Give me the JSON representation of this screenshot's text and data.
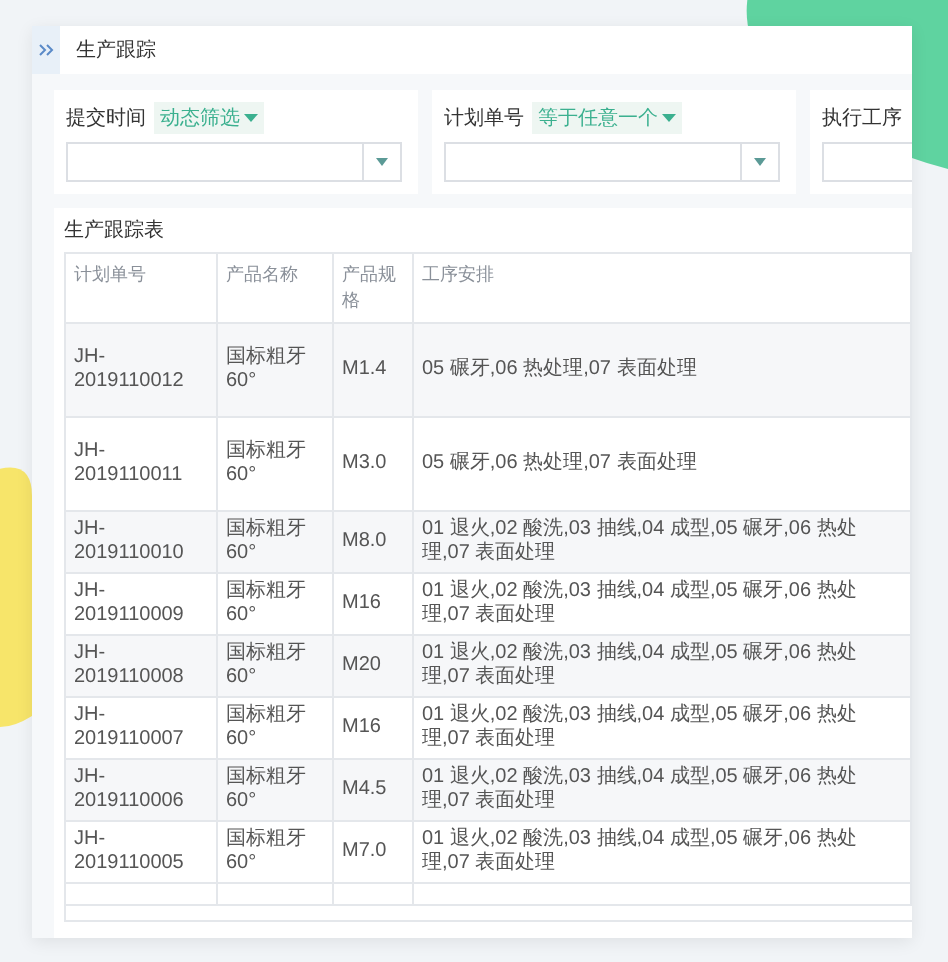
{
  "header": {
    "title": "生产跟踪"
  },
  "filters": [
    {
      "label": "提交时间",
      "operator": "动态筛选"
    },
    {
      "label": "计划单号",
      "operator": "等于任意一个"
    },
    {
      "label": "执行工序"
    }
  ],
  "table": {
    "title": "生产跟踪表",
    "columns": [
      "计划单号",
      "产品名称",
      "产品规格",
      "工序安排"
    ],
    "rows": [
      [
        "JH-2019110012",
        "国标粗牙60°",
        "M1.4",
        "05 碾牙,06 热处理,07 表面处理"
      ],
      [
        "JH-2019110011",
        "国标粗牙60°",
        "M3.0",
        "05 碾牙,06 热处理,07 表面处理"
      ],
      [
        "JH-2019110010",
        "国标粗牙60°",
        "M8.0",
        "01 退火,02 酸洗,03 抽线,04 成型,05 碾牙,06 热处理,07 表面处理"
      ],
      [
        "JH-2019110009",
        "国标粗牙60°",
        "M16",
        "01 退火,02 酸洗,03 抽线,04 成型,05 碾牙,06 热处理,07 表面处理"
      ],
      [
        "JH-2019110008",
        "国标粗牙60°",
        "M20",
        "01 退火,02 酸洗,03 抽线,04 成型,05 碾牙,06 热处理,07 表面处理"
      ],
      [
        "JH-2019110007",
        "国标粗牙60°",
        "M16",
        "01 退火,02 酸洗,03 抽线,04 成型,05 碾牙,06 热处理,07 表面处理"
      ],
      [
        "JH-2019110006",
        "国标粗牙60°",
        "M4.5",
        "01 退火,02 酸洗,03 抽线,04 成型,05 碾牙,06 热处理,07 表面处理"
      ],
      [
        "JH-2019110005",
        "国标粗牙60°",
        "M7.0",
        "01 退火,02 酸洗,03 抽线,04 成型,05 碾牙,06 热处理,07 表面处理"
      ]
    ]
  }
}
